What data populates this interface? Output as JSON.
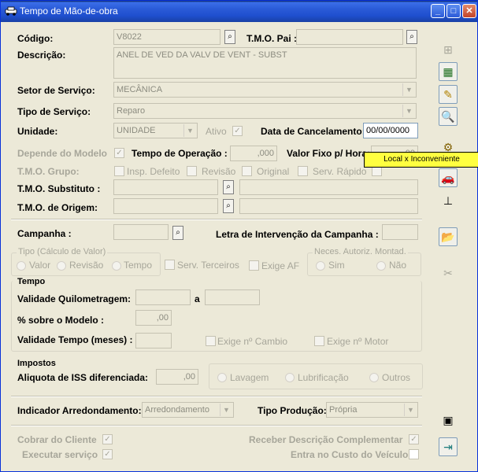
{
  "window": {
    "title": "Tempo de Mão-de-obra"
  },
  "titlebar_buttons": {
    "minimize": "_",
    "maximize": "□",
    "close": "✕"
  },
  "codigo": {
    "label": "Código:",
    "value": "V8022"
  },
  "tmo_pai": {
    "label": "T.M.O. Pai :",
    "value": ""
  },
  "descricao": {
    "label": "Descrição:",
    "value": "ANEL DE VED DA VALV DE VENT - SUBST"
  },
  "setor_servico": {
    "label": "Setor de Serviço:",
    "value": "MECÂNICA"
  },
  "tipo_servico": {
    "label": "Tipo de Serviço:",
    "value": "Reparo"
  },
  "unidade": {
    "label": "Unidade:",
    "value": "UNIDADE"
  },
  "ativo": {
    "label": "Ativo",
    "checked": "✓"
  },
  "data_cancelamento": {
    "label": "Data de Cancelamento:",
    "value": "00/00/0000"
  },
  "depende_modelo": {
    "label": "Depende do Modelo",
    "checked": "✓"
  },
  "tempo_operacao": {
    "label": "Tempo de Operação :",
    "value": ",000"
  },
  "valor_fixo": {
    "label": "Valor Fixo p/ Hora:",
    "value": ",00"
  },
  "tmo_grupo": {
    "label": "T.M.O. Grupo:"
  },
  "insp_defeito": {
    "label": "Insp. Defeito"
  },
  "revisao_chk": {
    "label": "Revisão"
  },
  "original": {
    "label": "Original"
  },
  "serv_rapido": {
    "label": "Serv. Rápido"
  },
  "tmo_substituto": {
    "label": "T.M.O. Substituto :",
    "value": "",
    "desc": ""
  },
  "tmo_origem": {
    "label": "T.M.O. de Origem:",
    "value": "",
    "desc": ""
  },
  "campanha": {
    "label": "Campanha :",
    "value": ""
  },
  "letra_intervencao": {
    "label": "Letra de Intervenção da Campanha :",
    "value": ""
  },
  "tipo_calculo": {
    "title": "Tipo (Cálculo de Valor)",
    "options": [
      "Valor",
      "Revisão",
      "Tempo"
    ]
  },
  "serv_terceiros": {
    "label": "Serv. Terceiros"
  },
  "exige_af": {
    "label": "Exige AF"
  },
  "neces_autoriz": {
    "title": "Neces. Autoriz. Montad.",
    "options": [
      "Sim",
      "Não"
    ]
  },
  "tempo_section": {
    "title": "Tempo"
  },
  "validade_km": {
    "label": "Validade Quilometragem:",
    "from": "",
    "sep": "a",
    "to": ""
  },
  "pct_modelo": {
    "label": "% sobre o Modelo :",
    "value": ",00"
  },
  "validade_tempo": {
    "label": "Validade Tempo (meses) :",
    "value": ""
  },
  "exige_cambio": {
    "label": "Exige nº Cambio"
  },
  "exige_motor": {
    "label": "Exige nº Motor"
  },
  "impostos_section": {
    "title": "Impostos"
  },
  "aliquota_iss": {
    "label": "Aliquota de ISS diferenciada:",
    "value": ",00"
  },
  "servicos_extra": {
    "options": [
      "Lavagem",
      "Lubrificação",
      "Outros"
    ]
  },
  "indicador_arred": {
    "label": "Indicador Arredondamento:",
    "value": "Arredondamento"
  },
  "tipo_producao": {
    "label": "Tipo Produção:",
    "value": "Própria"
  },
  "cobrar_cliente": {
    "label": "Cobrar do Cliente",
    "checked": "✓"
  },
  "executar_servico": {
    "label": "Executar serviço",
    "checked": "✓"
  },
  "receber_descricao": {
    "label": "Receber Descrição Complementar",
    "checked": "✓"
  },
  "entra_custo": {
    "label": "Entra no Custo do Veículo",
    "checked": ""
  },
  "tooltip": {
    "text": "Local x Inconveniente"
  }
}
